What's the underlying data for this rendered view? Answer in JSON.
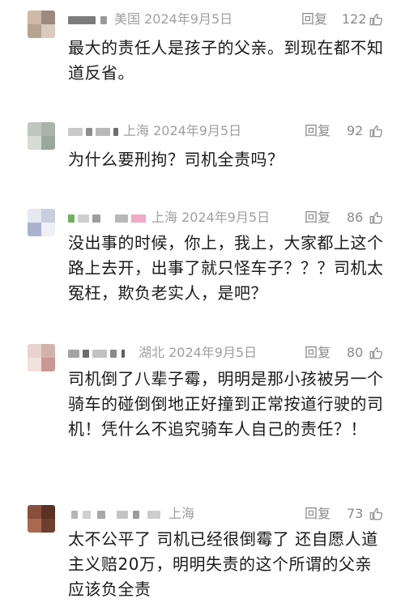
{
  "reply_label": "回复",
  "comments": [
    {
      "location_date": "美国 2024年9月5日",
      "likes": "122",
      "text": "最大的责任人是孩子的父亲。到现在都不知道反省。"
    },
    {
      "location_date": "上海 2024年9月5日",
      "likes": "92",
      "text": "为什么要刑拘？司机全责吗？"
    },
    {
      "location_date": "上海 2024年9月5日",
      "likes": "86",
      "text": "没出事的时候，你上，我上，大家都上这个路上去开，出事了就只怪车子？？？司机太冤枉，欺负老实人，是吧？"
    },
    {
      "location_date": "湖北 2024年9月5日",
      "likes": "80",
      "text": "司机倒了八辈子霉，明明是那小孩被另一个骑车的碰倒倒地正好撞到正常按道行驶的司机！凭什么不追究骑车人自己的责任？！"
    },
    {
      "location_date": "上海",
      "likes": "73",
      "text": "太不公平了 司机已经很倒霉了 还自愿人道主义赔20万，明明失责的这个所谓的父亲应该负全责"
    }
  ],
  "colors": {
    "meta_gray": "#a0a0a0",
    "text": "#1a1a1a"
  }
}
